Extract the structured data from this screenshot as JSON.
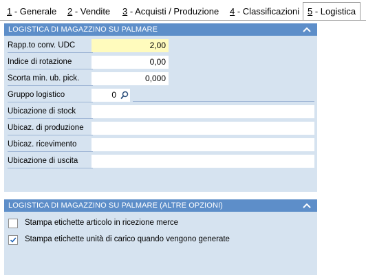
{
  "tabs": [
    {
      "mnemonic": "1",
      "label": " - Generale"
    },
    {
      "mnemonic": "2",
      "label": " - Vendite"
    },
    {
      "mnemonic": "3",
      "label": " - Acquisti / Produzione"
    },
    {
      "mnemonic": "4",
      "label": " - Classificazioni"
    },
    {
      "mnemonic": "5",
      "label": " - Logistica"
    }
  ],
  "active_tab": 4,
  "panel1": {
    "title": "LOGISTICA DI MAGAZZINO SU PALMARE",
    "fields": {
      "rapp_label": "Rapp.to conv. UDC",
      "rapp_value": "2,00",
      "indice_label": "Indice di rotazione",
      "indice_value": "0,00",
      "scorta_label": "Scorta min. ub.  pick.",
      "scorta_value": "0,000",
      "gruppo_label": "Gruppo logistico",
      "gruppo_value": "0",
      "ub_stock_label": "Ubicazione di stock",
      "ub_stock_value": "",
      "ub_prod_label": "Ubicaz. di produzione",
      "ub_prod_value": "",
      "ub_ric_label": "Ubicaz. ricevimento",
      "ub_ric_value": "",
      "ub_uscita_label": "Ubicazione di uscita",
      "ub_uscita_value": ""
    }
  },
  "panel2": {
    "title": "LOGISTICA DI MAGAZZINO SU PALMARE (ALTRE OPZIONI)",
    "options": [
      {
        "label": "Stampa etichette articolo in ricezione merce",
        "checked": false
      },
      {
        "label": "Stampa etichette unità di carico quando vengono generate",
        "checked": true
      }
    ]
  },
  "colors": {
    "header_bg": "#5d8ec9",
    "panel_bg": "#d6e3f0",
    "highlight_field": "#fffbbd",
    "check_color": "#1a5fb4"
  },
  "icons": {
    "collapse": "chevron-up-icon",
    "lookup": "search-icon",
    "check": "checkmark-icon"
  }
}
